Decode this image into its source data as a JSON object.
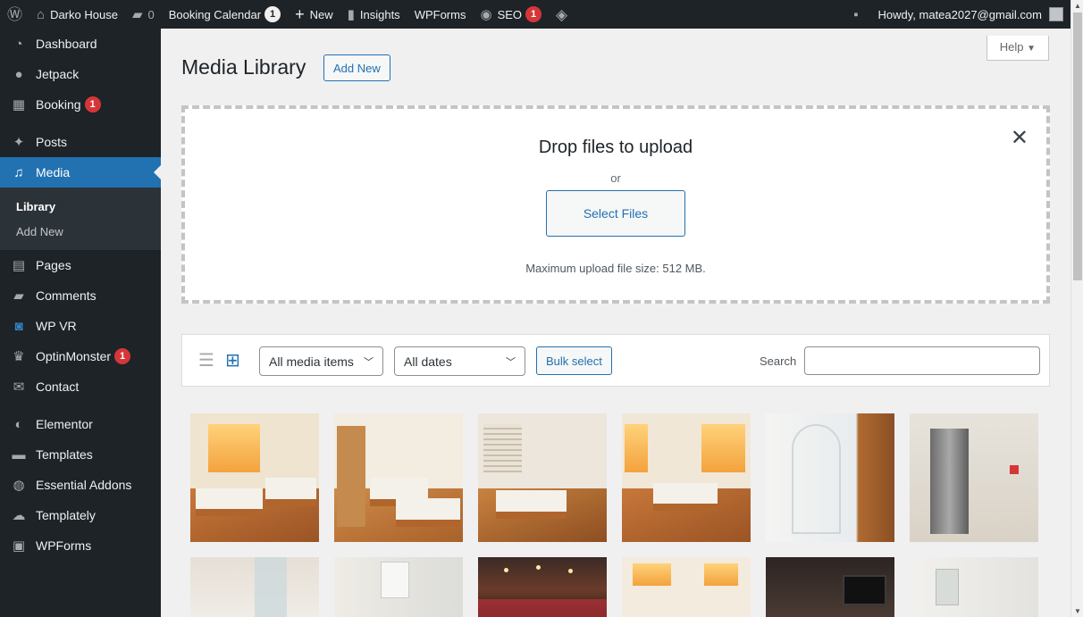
{
  "adminbar": {
    "site_name": "Darko House",
    "comments_count": "0",
    "booking_calendar": "Booking Calendar",
    "booking_calendar_badge": "1",
    "new_label": "New",
    "insights": "Insights",
    "wpforms": "WPForms",
    "seo": "SEO",
    "seo_badge": "1",
    "howdy": "Howdy, matea2027@gmail.com"
  },
  "sidebar": {
    "items": [
      {
        "label": "Dashboard",
        "icon": "dashboard-icon"
      },
      {
        "label": "Jetpack",
        "icon": "jetpack-icon"
      },
      {
        "label": "Booking",
        "icon": "booking-icon",
        "badge": "1"
      },
      {
        "label": "Posts",
        "icon": "pin-icon"
      },
      {
        "label": "Media",
        "icon": "media-icon",
        "current": true
      },
      {
        "label": "Pages",
        "icon": "pages-icon"
      },
      {
        "label": "Comments",
        "icon": "comment-icon"
      },
      {
        "label": "WP VR",
        "icon": "vr-icon"
      },
      {
        "label": "OptinMonster",
        "icon": "optinmonster-icon",
        "badge": "1"
      },
      {
        "label": "Contact",
        "icon": "mail-icon"
      },
      {
        "label": "Elementor",
        "icon": "elementor-icon"
      },
      {
        "label": "Templates",
        "icon": "folder-icon"
      },
      {
        "label": "Essential Addons",
        "icon": "essential-addons-icon"
      },
      {
        "label": "Templately",
        "icon": "templately-icon"
      },
      {
        "label": "WPForms",
        "icon": "wpforms-icon"
      }
    ],
    "submenu": [
      {
        "label": "Library",
        "active": true
      },
      {
        "label": "Add New"
      }
    ]
  },
  "main": {
    "help": "Help",
    "title": "Media Library",
    "add_new": "Add New",
    "upload": {
      "title": "Drop files to upload",
      "or": "or",
      "select_files": "Select Files",
      "max_size": "Maximum upload file size: 512 MB."
    },
    "toolbar": {
      "filter_type": "All media items",
      "filter_date": "All dates",
      "bulk_select": "Bulk select",
      "search_label": "Search",
      "search_value": ""
    }
  }
}
